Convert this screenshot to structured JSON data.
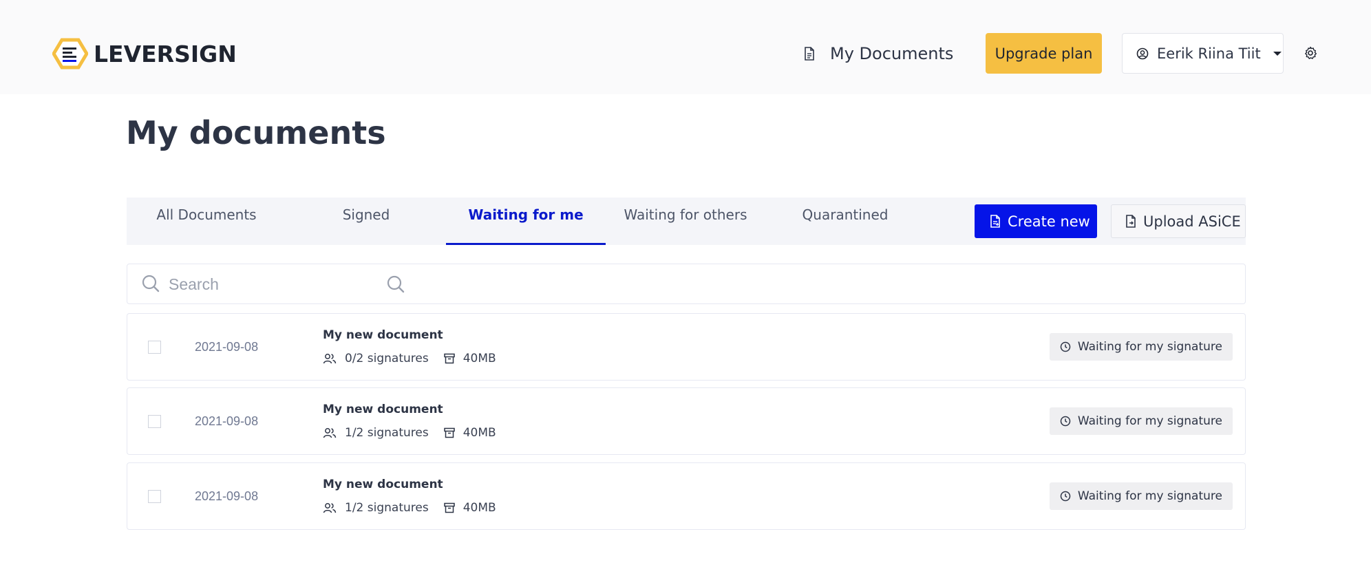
{
  "header": {
    "brand": "LEVERSIGN",
    "nav_documents": "My Documents",
    "upgrade_label": "Upgrade plan",
    "user_name": "Eerik Riina Tiit"
  },
  "colors": {
    "accent": "#0514e8",
    "brand_yellow": "#f5bf42",
    "active_tab": "#0a1acb"
  },
  "page": {
    "title": "My documents"
  },
  "tabs": [
    {
      "label": "All Documents",
      "active": false
    },
    {
      "label": "Signed",
      "active": false
    },
    {
      "label": "Waiting for me",
      "active": true
    },
    {
      "label": "Waiting for others",
      "active": false
    },
    {
      "label": "Quarantined",
      "active": false
    }
  ],
  "actions": {
    "create_label": "Create new",
    "upload_label": "Upload ASiCE"
  },
  "search": {
    "placeholder": "Search",
    "value": ""
  },
  "documents": [
    {
      "date": "2021-09-08",
      "title": "My new document",
      "signatures": "0/2 signatures",
      "size": "40MB",
      "status": "Waiting for my signature"
    },
    {
      "date": "2021-09-08",
      "title": "My new document",
      "signatures": "1/2 signatures",
      "size": "40MB",
      "status": "Waiting for my signature"
    },
    {
      "date": "2021-09-08",
      "title": "My new document",
      "signatures": "1/2 signatures",
      "size": "40MB",
      "status": "Waiting for my signature"
    }
  ]
}
